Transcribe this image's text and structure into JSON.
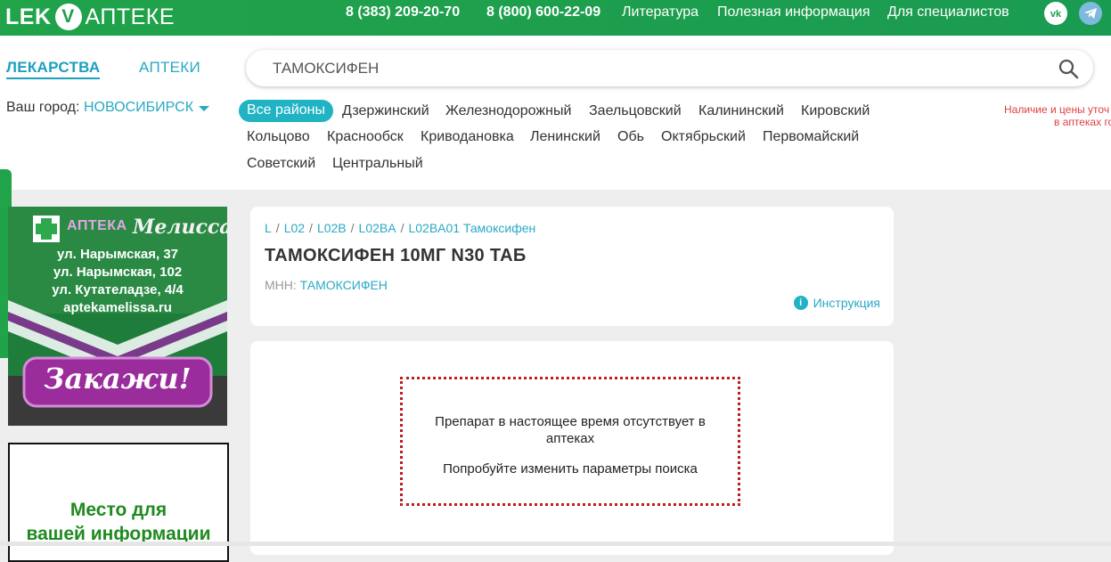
{
  "brand": {
    "logo_left": "LEK",
    "logo_v": "V",
    "logo_right": "АПТЕКЕ",
    "accent": "#21a34a",
    "teal": "#1fb3c4"
  },
  "topbar": {
    "phone1": "8 (383) 209-20-70",
    "phone2": "8 (800) 600-22-09",
    "links": [
      "Литература",
      "Полезная информация",
      "Для специалистов"
    ],
    "social": [
      "vk-icon",
      "telegram-icon"
    ]
  },
  "nav": {
    "tabs": [
      "ЛЕКАРСТВА",
      "АПТЕКИ"
    ],
    "active": "ЛЕКАРСТВА"
  },
  "city": {
    "label": "Ваш город:",
    "value": "НОВОСИБИРСК"
  },
  "search": {
    "value": "ТАМОКСИФЕН",
    "icon": "search-icon"
  },
  "districts": [
    "Все районы",
    "Дзержинский",
    "Железнодорожный",
    "Заельцовский",
    "Калининский",
    "Кировский",
    "Кольцово",
    "Краснообск",
    "Криводановка",
    "Ленинский",
    "Обь",
    "Октябрьский",
    "Первомайский",
    "Советский",
    "Центральный"
  ],
  "selected_district": "Все районы",
  "side_note": {
    "line1": "Наличие и цены уточ",
    "line2": "в аптеках го"
  },
  "ad_banner": {
    "brand_word": "АПТЕКА",
    "brand_name": "Мелисса",
    "addresses": [
      "ул. Нарымская, 37",
      "ул. Нарымская, 102",
      "ул. Кутателадзе, 4/4"
    ],
    "site": "aptekamelissa.ru",
    "cta": "Закажи!"
  },
  "ad_placeholder": {
    "line1": "Место для",
    "line2": "вашей информации"
  },
  "product": {
    "breadcrumbs": [
      "L",
      "L02",
      "L02B",
      "L02BA",
      "L02BA01 Тамоксифен"
    ],
    "title": "ТАМОКСИФЕН 10МГ N30 ТАБ",
    "mnn_label": "МНН:",
    "mnn_value": "ТАМОКСИФЕН",
    "instruction": "Инструкция"
  },
  "availability": {
    "line1": "Препарат в настоящее время отсутствует в",
    "line2": "аптеках",
    "hint": "Попробуйте изменить параметры поиска"
  }
}
